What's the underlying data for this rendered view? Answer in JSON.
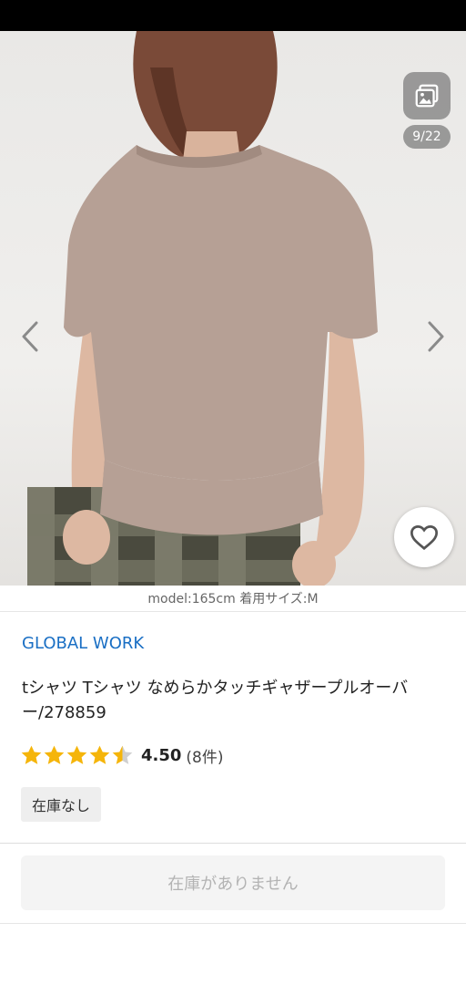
{
  "gallery": {
    "counter": "9/22",
    "icon": "gallery-icon",
    "prev_icon": "chevron-left-icon",
    "next_icon": "chevron-right-icon",
    "favorite_icon": "heart-icon"
  },
  "caption": "model:165cm 着用サイズ:M",
  "product": {
    "brand": "GLOBAL WORK",
    "title": "tシャツ Tシャツ なめらかタッチギャザープルオーバー/278859",
    "rating": {
      "value": 4.5,
      "value_text": "4.50",
      "count_text": "(8件)",
      "max": 5
    },
    "stock_tag": "在庫なし"
  },
  "purchase_button": {
    "label": "在庫がありません"
  },
  "colors": {
    "brand": "#1a6fc4",
    "star": "#f5b50a",
    "star_empty": "#cfcfcf"
  }
}
